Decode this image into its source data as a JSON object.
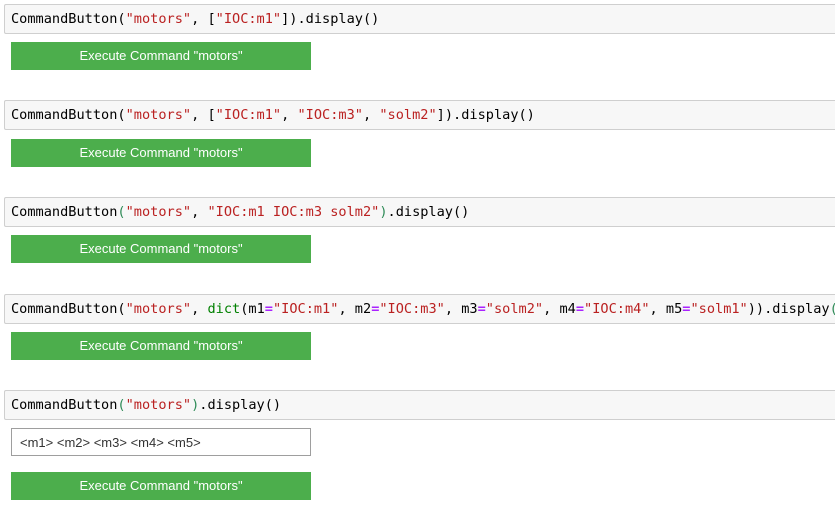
{
  "cells": [
    {
      "tokens": [
        {
          "t": "CommandButton",
          "c": "plain"
        },
        {
          "t": "(",
          "c": "plain"
        },
        {
          "t": "\"motors\"",
          "c": "str"
        },
        {
          "t": ", [",
          "c": "plain"
        },
        {
          "t": "\"IOC:m1\"",
          "c": "str"
        },
        {
          "t": "]).display()",
          "c": "plain"
        }
      ],
      "button_label": "Execute Command \"motors\""
    },
    {
      "tokens": [
        {
          "t": "CommandButton",
          "c": "plain"
        },
        {
          "t": "(",
          "c": "plain"
        },
        {
          "t": "\"motors\"",
          "c": "str"
        },
        {
          "t": ", [",
          "c": "plain"
        },
        {
          "t": "\"IOC:m1\"",
          "c": "str"
        },
        {
          "t": ", ",
          "c": "plain"
        },
        {
          "t": "\"IOC:m3\"",
          "c": "str"
        },
        {
          "t": ", ",
          "c": "plain"
        },
        {
          "t": "\"solm2\"",
          "c": "str"
        },
        {
          "t": "]).display()",
          "c": "plain"
        }
      ],
      "button_label": "Execute Command \"motors\""
    },
    {
      "tokens": [
        {
          "t": "CommandButton",
          "c": "plain"
        },
        {
          "t": "(",
          "c": "br"
        },
        {
          "t": "\"motors\"",
          "c": "str"
        },
        {
          "t": ", ",
          "c": "plain"
        },
        {
          "t": "\"IOC:m1 IOC:m3 solm2\"",
          "c": "str"
        },
        {
          "t": ")",
          "c": "br"
        },
        {
          "t": ".display()",
          "c": "plain"
        }
      ],
      "button_label": "Execute Command \"motors\""
    },
    {
      "tokens": [
        {
          "t": "CommandButton",
          "c": "plain"
        },
        {
          "t": "(",
          "c": "plain"
        },
        {
          "t": "\"motors\"",
          "c": "str"
        },
        {
          "t": ", ",
          "c": "plain"
        },
        {
          "t": "dict",
          "c": "bi"
        },
        {
          "t": "(m1",
          "c": "plain"
        },
        {
          "t": "=",
          "c": "op"
        },
        {
          "t": "\"IOC:m1\"",
          "c": "str"
        },
        {
          "t": ", m2",
          "c": "plain"
        },
        {
          "t": "=",
          "c": "op"
        },
        {
          "t": "\"IOC:m3\"",
          "c": "str"
        },
        {
          "t": ", m3",
          "c": "plain"
        },
        {
          "t": "=",
          "c": "op"
        },
        {
          "t": "\"solm2\"",
          "c": "str"
        },
        {
          "t": ", m4",
          "c": "plain"
        },
        {
          "t": "=",
          "c": "op"
        },
        {
          "t": "\"IOC:m4\"",
          "c": "str"
        },
        {
          "t": ", m5",
          "c": "plain"
        },
        {
          "t": "=",
          "c": "op"
        },
        {
          "t": "\"solm1\"",
          "c": "str"
        },
        {
          "t": ")).display",
          "c": "plain"
        },
        {
          "t": "()",
          "c": "br"
        }
      ],
      "button_label": "Execute Command \"motors\""
    },
    {
      "tokens": [
        {
          "t": "CommandButton",
          "c": "plain"
        },
        {
          "t": "(",
          "c": "br"
        },
        {
          "t": "\"motors\"",
          "c": "str"
        },
        {
          "t": ")",
          "c": "br"
        },
        {
          "t": ".display()",
          "c": "plain"
        }
      ],
      "input_value": "<m1> <m2> <m3> <m4> <m5>",
      "button_label": "Execute Command \"motors\""
    }
  ]
}
